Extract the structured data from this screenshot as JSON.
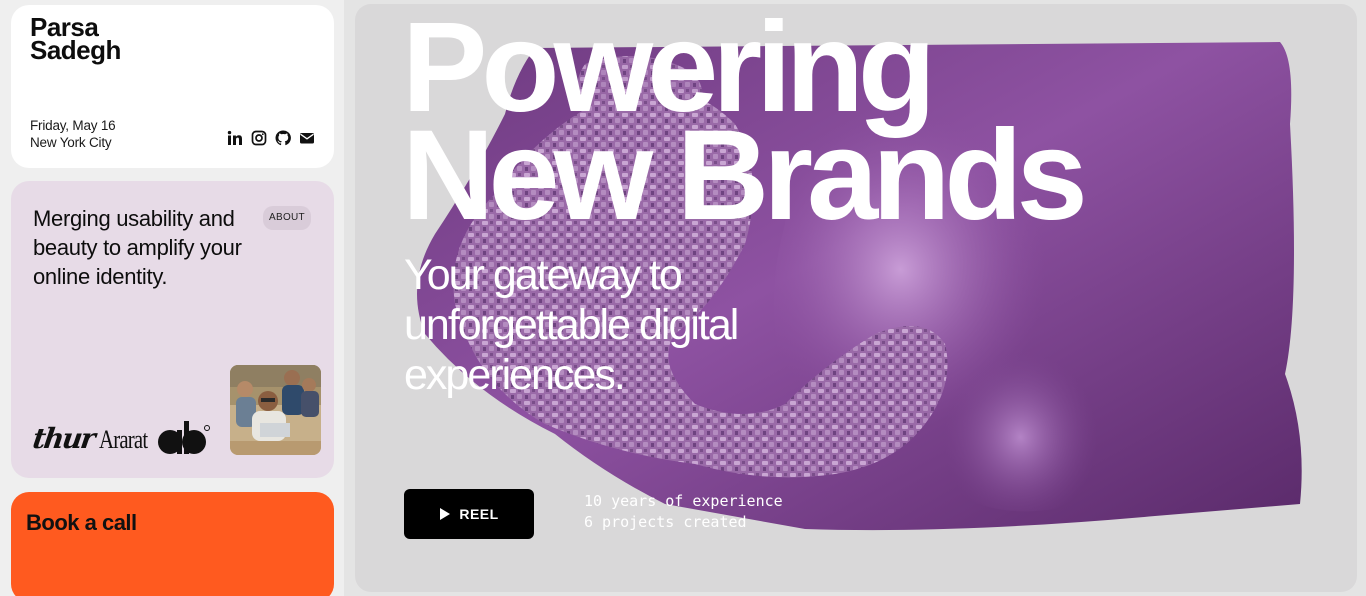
{
  "profile": {
    "first_name": "Parsa",
    "last_name": "Sadegh",
    "date": "Friday, May 16",
    "city": "New York City",
    "socials": [
      "linkedin-icon",
      "instagram-icon",
      "github-icon",
      "mail-icon"
    ]
  },
  "about": {
    "text": "Merging usability and beauty to amplify your online identity.",
    "badge": "ABOUT",
    "logos": {
      "script": "thur",
      "ararat": "Ararat",
      "ab_mark": "ab"
    }
  },
  "call": {
    "label": "Book a call"
  },
  "hero": {
    "headline_line1": "Powering",
    "headline_line2": "New Brands",
    "subhead": "Your gateway to unforgettable digital experiences.",
    "reel_label": "REEL",
    "stat_years": "10 years of experience",
    "stat_projects": "6 projects created"
  },
  "colors": {
    "accent_orange": "#ff5a1f",
    "about_bg": "#e7dbe7",
    "hero_bg": "#d9d8d9",
    "purple_art": "#8a4a9a"
  }
}
